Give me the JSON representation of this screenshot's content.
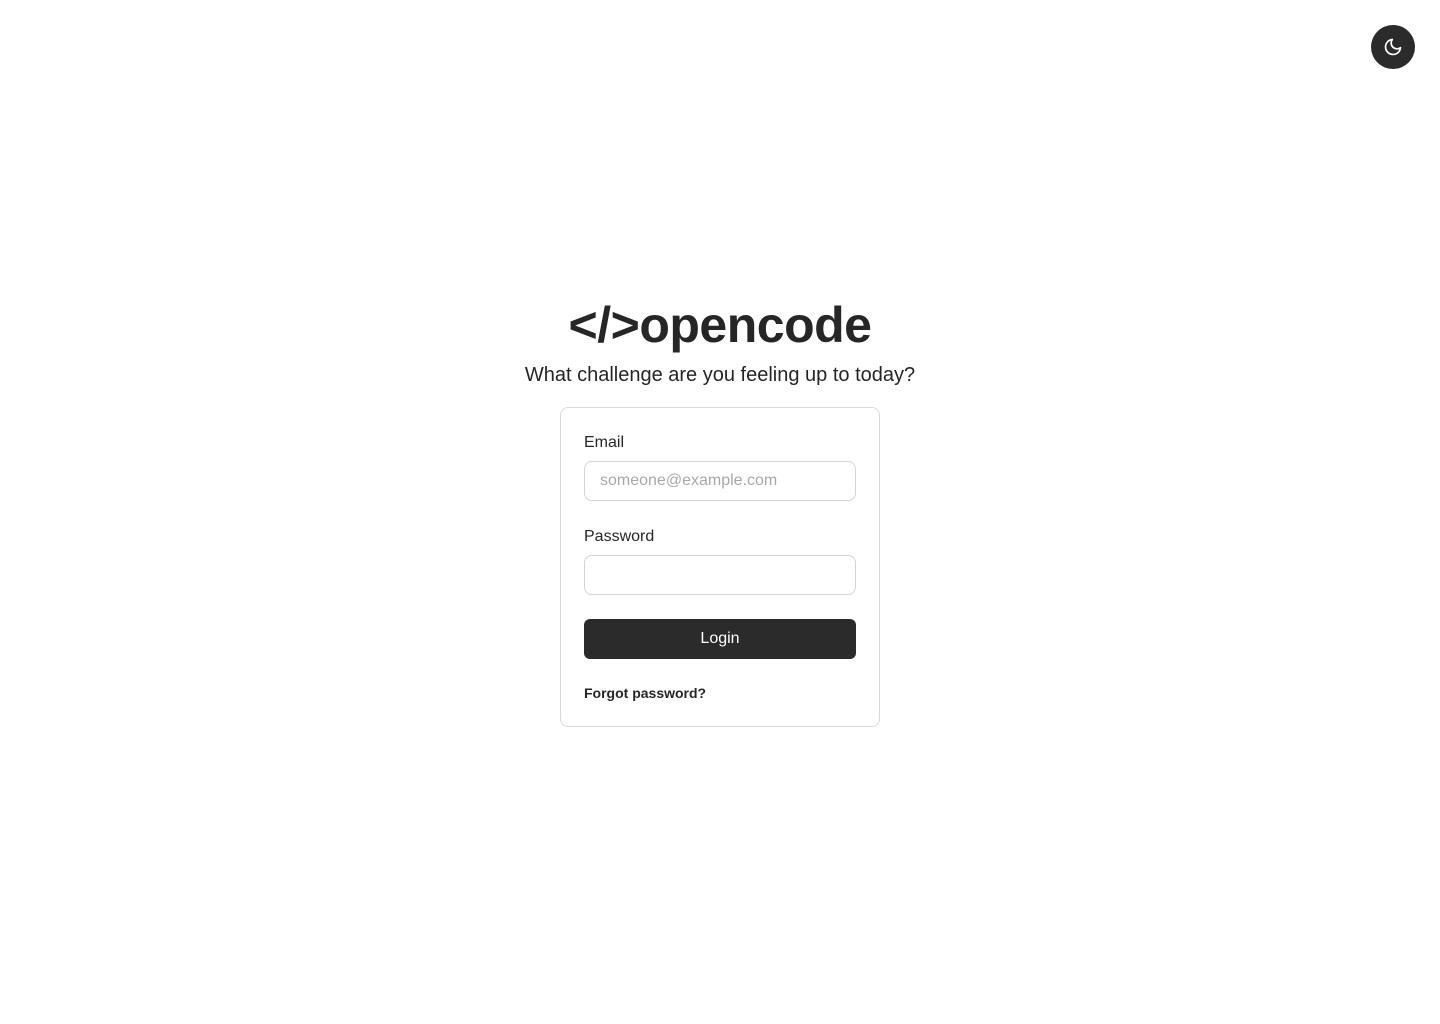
{
  "theme_toggle": {
    "icon": "moon-icon",
    "background": "#2b2b2b"
  },
  "brand": {
    "logo_text": "</>opencode",
    "tagline": "What challenge are you feeling up to today?"
  },
  "login_form": {
    "email_label": "Email",
    "email_placeholder": "someone@example.com",
    "email_value": "",
    "password_label": "Password",
    "password_value": "",
    "submit_label": "Login",
    "forgot_password_label": "Forgot password?"
  },
  "colors": {
    "primary": "#2b2b2b",
    "text": "#262626",
    "border": "#d9d9d9",
    "placeholder": "#a8a8a8"
  }
}
